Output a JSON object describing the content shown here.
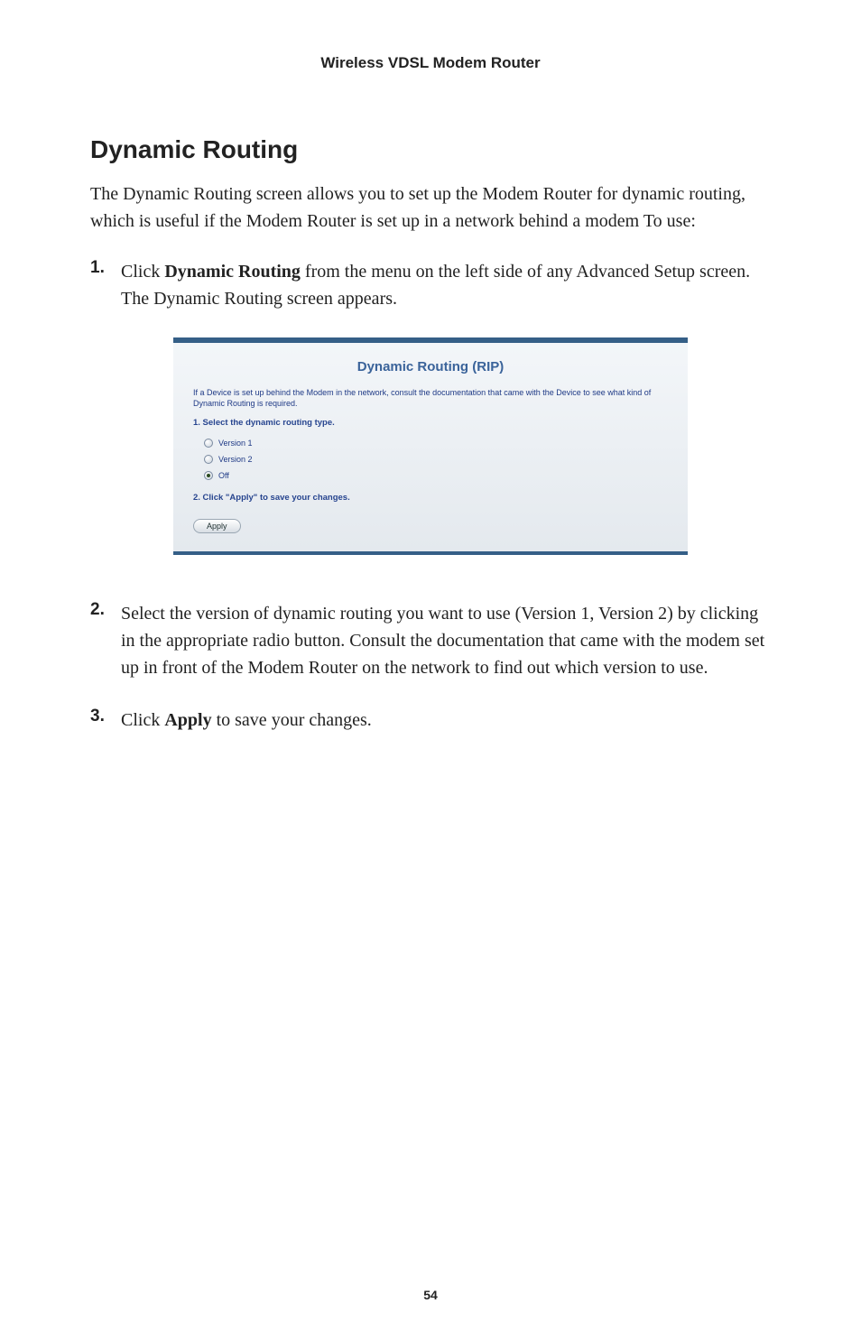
{
  "header": {
    "title": "Wireless VDSL Modem Router"
  },
  "section": {
    "heading": "Dynamic Routing",
    "intro": "The Dynamic Routing screen allows you to set up the Modem Router for dynamic routing, which is useful if the Modem Router is set up in a network behind a modem To use:"
  },
  "steps": [
    {
      "num": "1.",
      "parts": [
        {
          "text": "Click ",
          "bold": false
        },
        {
          "text": "Dynamic Routing",
          "bold": true
        },
        {
          "text": " from the menu on the left side of any Advanced Setup screen. The Dynamic Routing screen appears.",
          "bold": false
        }
      ]
    },
    {
      "num": "2.",
      "parts": [
        {
          "text": "Select the version of dynamic routing you want to use (Version 1, Version 2) by clicking in the appropriate radio button. Consult the documentation that came with the modem set up in front of the Modem Router on the network to find out which version to use.",
          "bold": false
        }
      ]
    },
    {
      "num": "3.",
      "parts": [
        {
          "text": "Click ",
          "bold": false
        },
        {
          "text": "Apply",
          "bold": true
        },
        {
          "text": " to save your changes.",
          "bold": false
        }
      ]
    }
  ],
  "panel": {
    "title": "Dynamic Routing (RIP)",
    "desc": "If a Device is set up behind the Modem in the network, consult the documentation that came with the Device to see what kind of Dynamic Routing is required.",
    "sub1": "1. Select the dynamic routing type.",
    "options": [
      {
        "label": "Version 1",
        "checked": false
      },
      {
        "label": "Version 2",
        "checked": false
      },
      {
        "label": "Off",
        "checked": true
      }
    ],
    "sub2": "2. Click \"Apply\" to save your changes.",
    "apply": "Apply"
  },
  "footer": {
    "page_number": "54"
  }
}
